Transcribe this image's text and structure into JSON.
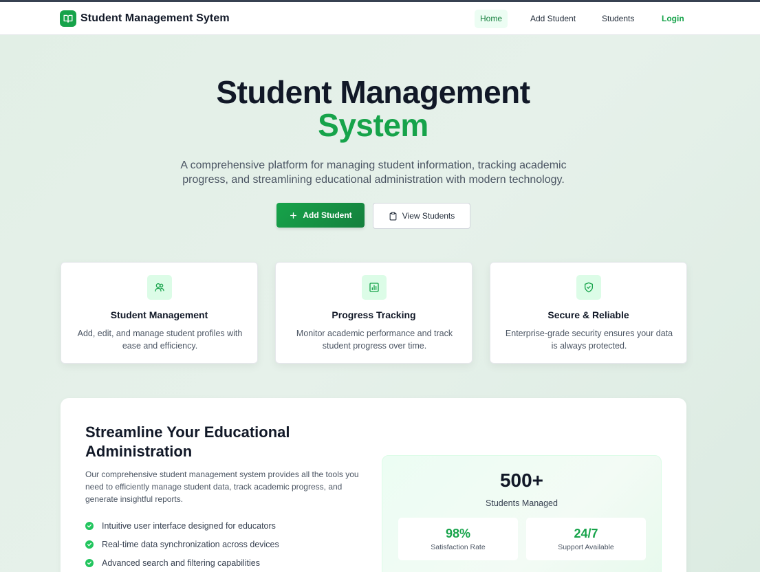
{
  "nav": {
    "brand": "Student Management Sytem",
    "links": [
      "Home",
      "Add Student",
      "Students",
      "Login"
    ]
  },
  "hero": {
    "title_line1": "Student Management",
    "title_line2": "System",
    "subtitle": "A comprehensive platform for managing student information, tracking academic progress, and streamlining educational administration with modern technology.",
    "primary_button": "Add Student",
    "secondary_button": "View Students"
  },
  "features": [
    {
      "title": "Student Management",
      "description": "Add, edit, and manage student profiles with ease and efficiency.",
      "icon": "users-icon"
    },
    {
      "title": "Progress Tracking",
      "description": "Monitor academic performance and track student progress over time.",
      "icon": "bar-chart-icon"
    },
    {
      "title": "Secure & Reliable",
      "description": "Enterprise-grade security ensures your data is always protected.",
      "icon": "shield-check-icon"
    }
  ],
  "panel": {
    "title": "Streamline Your Educational Administration",
    "description": "Our comprehensive student management system provides all the tools you need to efficiently manage student data, track academic progress, and generate insightful reports.",
    "checklist": [
      "Intuitive user interface designed for educators",
      "Real-time data synchronization across devices",
      "Advanced search and filtering capabilities"
    ]
  },
  "stats": {
    "main_value": "500+",
    "main_label": "Students Managed",
    "items": [
      {
        "value": "98%",
        "label": "Satisfaction Rate"
      },
      {
        "value": "24/7",
        "label": "Support Available"
      }
    ]
  },
  "colors": {
    "accent": "#16a34a",
    "accent_light": "#dcfce7",
    "text_dark": "#111827"
  }
}
